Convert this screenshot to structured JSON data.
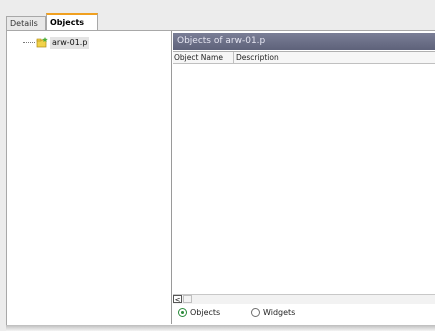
{
  "tabs": {
    "details": "Details",
    "objects": "Objects"
  },
  "tree": {
    "item_label": "arw-01.p",
    "item_icon": "file-star-icon"
  },
  "right": {
    "header_title": "Objects of arw-01.p",
    "columns": [
      "Object Name",
      "Description"
    ]
  },
  "scroll": {
    "left_glyph": "<"
  },
  "radios": {
    "objects": "Objects",
    "widgets": "Widgets",
    "selected": "Objects"
  },
  "colors": {
    "tab_accent": "#f0a020",
    "header_bg": "#6a6e86",
    "radio_selected": "#2a8a3a"
  }
}
